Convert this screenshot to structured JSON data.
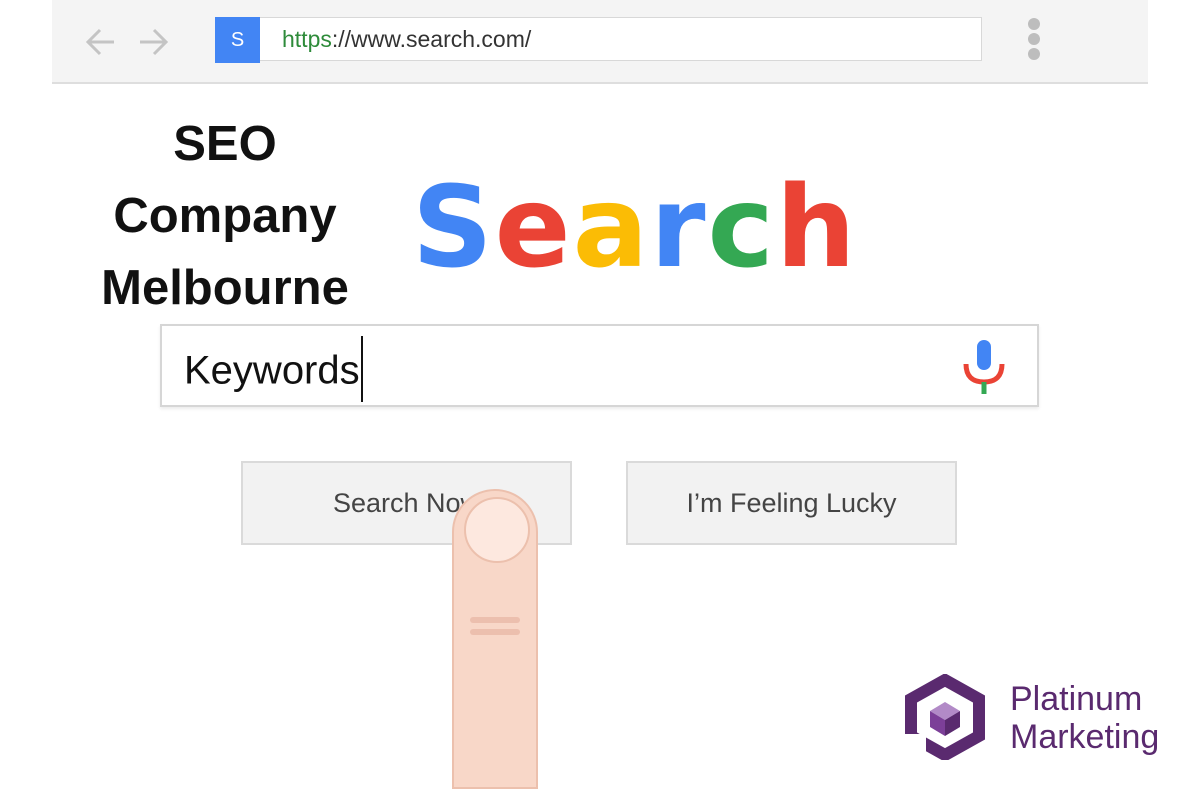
{
  "browser": {
    "site_badge": "S",
    "url_scheme": "https",
    "url_rest": "://www.search.com/"
  },
  "heading": {
    "line1": "SEO",
    "line2": "Company",
    "line3": "Melbourne"
  },
  "logo": {
    "letters": [
      "S",
      "e",
      "a",
      "r",
      "c",
      "h"
    ],
    "colors": [
      "#4285f4",
      "#ea4335",
      "#fbbc05",
      "#4285f4",
      "#34a853",
      "#ea4335"
    ]
  },
  "search": {
    "value": "Keywords"
  },
  "buttons": {
    "search_now": "Search Now",
    "feeling_lucky": "I’m Feeling Lucky"
  },
  "brand": {
    "line1": "Platinum",
    "line2": "Marketing",
    "color": "#5a2a6f"
  },
  "icons": {
    "back": "back-arrow-icon",
    "forward": "forward-arrow-icon",
    "menu": "kebab-menu-icon",
    "mic": "microphone-icon"
  }
}
